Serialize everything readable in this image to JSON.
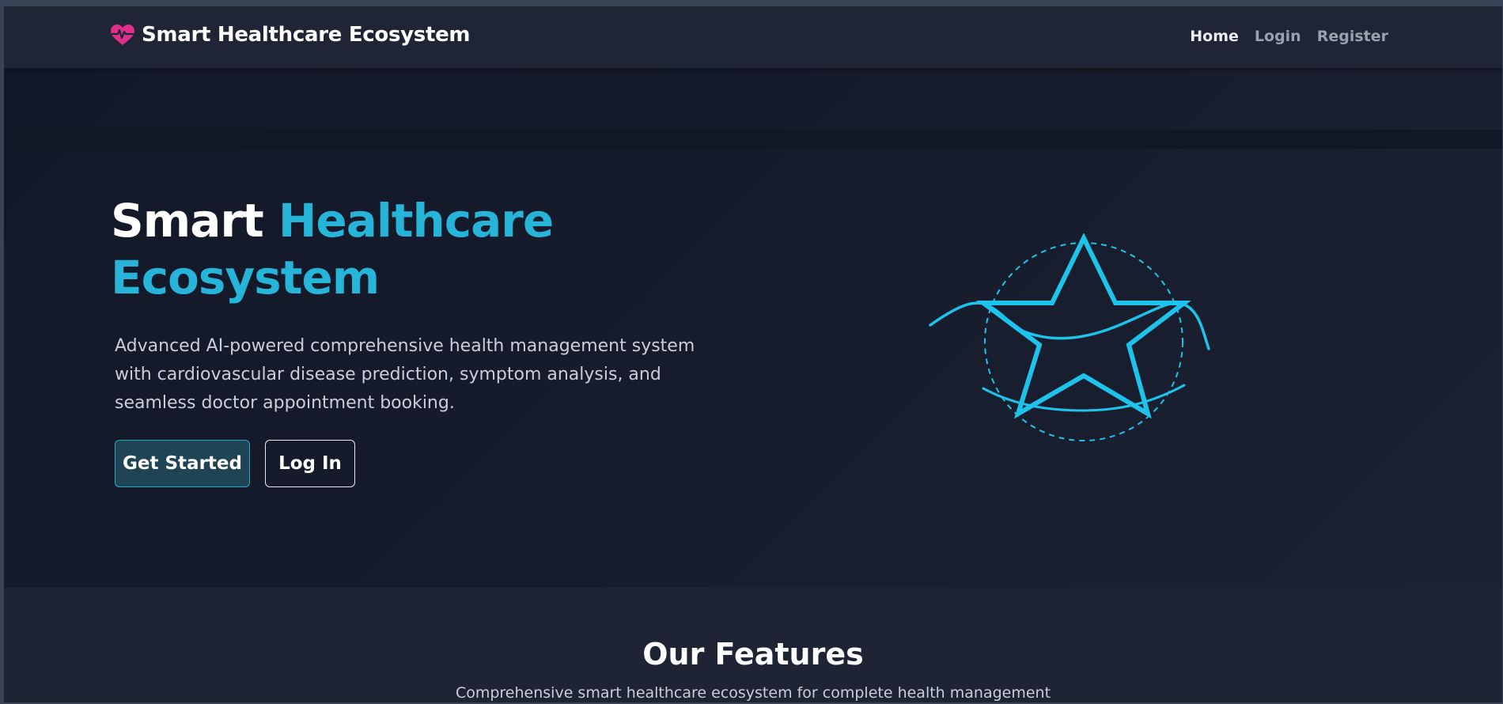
{
  "navbar": {
    "brand_name": "Smart Healthcare Ecosystem",
    "brand_icon": "heart-pulse-icon",
    "links": [
      {
        "label": "Home",
        "active": true
      },
      {
        "label": "Login",
        "active": false
      },
      {
        "label": "Register",
        "active": false
      }
    ]
  },
  "hero": {
    "title_plain": "Smart ",
    "title_accent": "Healthcare Ecosystem",
    "description": "Advanced AI-powered comprehensive health management system with cardiovascular disease prediction, symptom analysis, and seamless doctor appointment booking.",
    "primary_button": "Get Started",
    "secondary_button": "Log In",
    "illustration_icon": "star-wave-icon"
  },
  "features": {
    "title": "Our Features",
    "subtitle": "Comprehensive smart healthcare ecosystem for complete health management"
  },
  "colors": {
    "accent": "#26b4d8",
    "illustration": "#1ec3ec",
    "brand_icon": "#e0308c",
    "background": "#151b2a"
  }
}
